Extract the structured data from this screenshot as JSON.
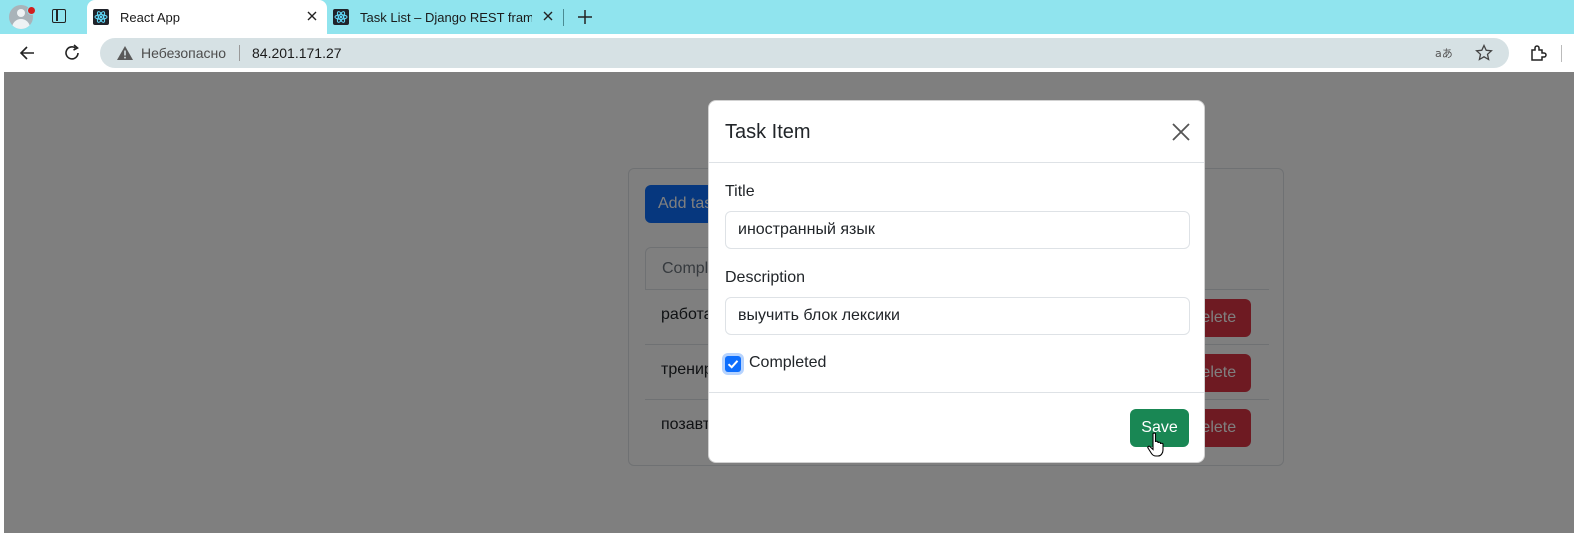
{
  "browser": {
    "tabs": [
      {
        "title": "React App",
        "active": true
      },
      {
        "title": "Task List – Django REST framework",
        "active": false
      }
    ],
    "address": {
      "security_label": "Небезопасно",
      "url": "84.201.171.27"
    }
  },
  "page": {
    "add_button_label": "Add task",
    "tab_label": "Complete",
    "tasks": [
      {
        "title": "работа",
        "delete_label": "Delete"
      },
      {
        "title": "тренировка",
        "delete_label": "Delete"
      },
      {
        "title": "позавтракать",
        "delete_label": "Delete"
      }
    ]
  },
  "modal": {
    "title": "Task Item",
    "title_label": "Title",
    "title_value": "иностранный язык",
    "description_label": "Description",
    "description_value": "выучить блок лексики",
    "completed_label": "Completed",
    "completed_checked": true,
    "save_label": "Save"
  },
  "colors": {
    "tabstrip": "#90e4ee",
    "primary": "#0d6efd",
    "danger": "#dc3545",
    "success": "#198754"
  },
  "icons": [
    "profile-avatar-icon",
    "tab-actions-icon",
    "react-favicon-icon",
    "close-icon",
    "plus-icon",
    "back-arrow-icon",
    "refresh-icon",
    "warning-icon",
    "translate-icon",
    "star-icon",
    "extensions-icon",
    "hand-cursor-icon"
  ]
}
